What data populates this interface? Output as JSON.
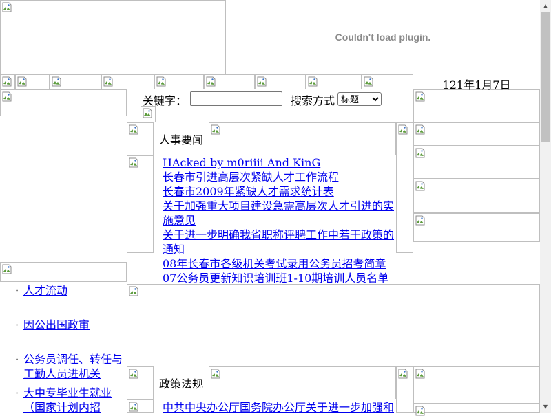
{
  "plugin_message": "Couldn't load plugin.",
  "date_text": "121年1月7日",
  "search": {
    "keyword_label": "关键字：",
    "keyword_value": "",
    "mode_label": "搜索方式",
    "mode_selected": "标题"
  },
  "sections": {
    "personnel_news_title": "人事要闻",
    "policy_title": "政策法规"
  },
  "personnel_news": [
    "HAcked by m0riiii And KinG",
    "长春市引进高层次紧缺人才工作流程",
    "长春市2009年紧缺人才需求统计表",
    "关于加强重大项目建设急需高层次人才引进的实施意见",
    "关于进一步明确我省职称评聘工作中若干政策的通知",
    "08年长春市各级机关考试录用公务员招考简章",
    "07公务员更新知识培训班1-10期培训人员名单"
  ],
  "policy_news": [
    "中共中央办公厅国务院办公厅关于进一步加强和"
  ],
  "sidebar_links": [
    "人才流动",
    "因公出国政审",
    "公务员调任、转任与工勤人员进机关",
    "大中专毕业生就业（国家计划内招"
  ]
}
